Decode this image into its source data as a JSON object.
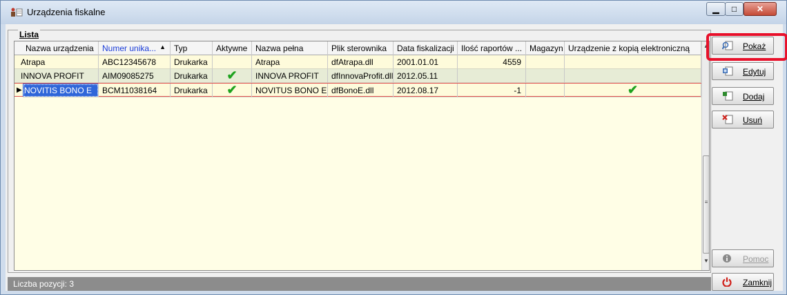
{
  "window": {
    "title": "Urządzenia fiskalne"
  },
  "group": {
    "title": "Lista"
  },
  "columns": [
    "Nazwa urządzenia",
    "Numer unika...",
    "Typ",
    "Aktywne",
    "Nazwa pełna",
    "Plik sterownika",
    "Data fiskalizacji",
    "Ilość raportów ...",
    "Magazyn",
    "Urządzenie z kopią elektroniczną"
  ],
  "rows": [
    [
      "Atrapa",
      "ABC12345678",
      "Drukarka",
      "",
      "Atrapa",
      "dfAtrapa.dll",
      "2001.01.01",
      "4559",
      "",
      ""
    ],
    [
      "INNOVA PROFIT",
      "AIM09085275",
      "Drukarka",
      "✔",
      "INNOVA PROFIT",
      "dfInnovaProfit.dll",
      "2012.05.11",
      "",
      "",
      ""
    ],
    [
      "NOVITIS BONO E",
      "BCM11038164",
      "Drukarka",
      "✔",
      "NOVITUS BONO E",
      "dfBonoE.dll",
      "2012.08.17",
      "-1",
      "",
      "✔"
    ]
  ],
  "status": {
    "label": "Liczba pozycji: 3"
  },
  "buttons": {
    "show": "Pokaż",
    "edit": "Edytuj",
    "add": "Dodaj",
    "delete": "Usuń",
    "help": "Pomoc",
    "close": "Zamknij"
  },
  "colors": {
    "selection": "#2f66d9",
    "checkmark": "#1ea21e",
    "highlight": "#e8102a"
  }
}
